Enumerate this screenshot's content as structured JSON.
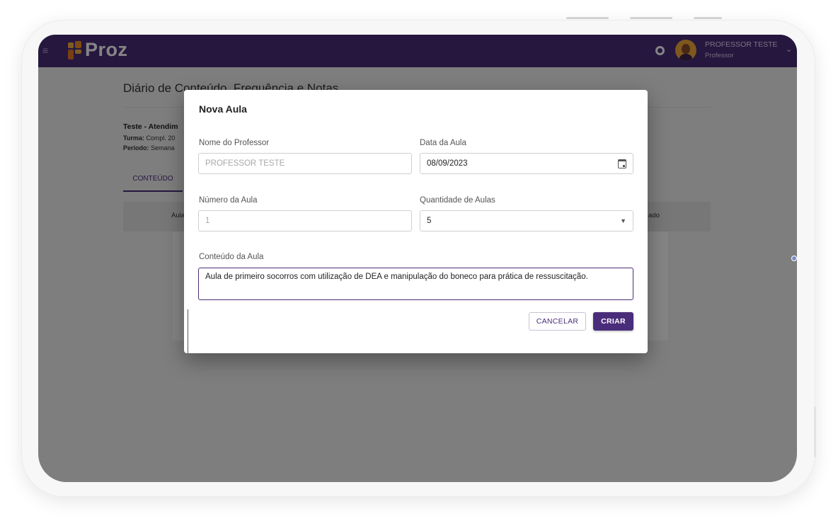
{
  "app": {
    "brand": "Proz",
    "user_name": "PROFESSOR TESTE",
    "user_role": "Professor"
  },
  "background_page": {
    "title": "Diário de Conteúdo, Frequência e Notas",
    "info_title": "Teste - Atendim",
    "turma_label": "Turma:",
    "turma_value": "Compl. 20",
    "periodo_label": "Período:",
    "periodo_value": "Semana",
    "tab": "CONTEÚDO",
    "tabbar_left": "Aula",
    "tabbar_right": "ado"
  },
  "dialog": {
    "title": "Nova Aula",
    "teacher_label": "Nome do Professor",
    "teacher_value": "PROFESSOR TESTE",
    "date_label": "Data da Aula",
    "date_value": "08/09/2023",
    "lesson_number_label": "Número da Aula",
    "lesson_number_value": "1",
    "lesson_count_label": "Quantidade de Aulas",
    "lesson_count_value": "5",
    "content_label": "Conteúdo da Aula",
    "content_value": "Aula de primeiro socorros com utilização de DEA e manipulação do boneco para prática de ressuscitação.",
    "cancel_label": "CANCELAR",
    "create_label": "CRIAR"
  },
  "colors": {
    "brand_purple": "#4a2d7a",
    "logo_orange": "#f28c28",
    "avatar_bg": "#f2a93b"
  },
  "icons": [
    "menu-icon",
    "proz-logo-icon",
    "notification-icon",
    "chevron-down-icon",
    "calendar-icon",
    "dropdown-arrow-icon"
  ]
}
